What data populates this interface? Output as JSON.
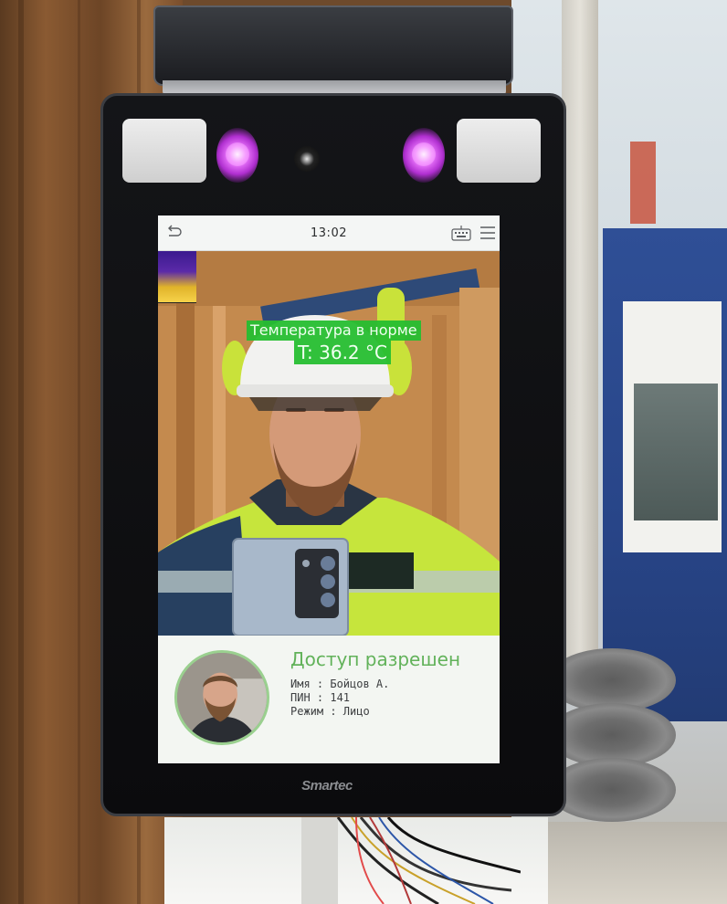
{
  "device": {
    "brand": "Smartec"
  },
  "status_bar": {
    "time": "13:02",
    "back_icon": "back-arrow-icon",
    "keyboard_icon": "keyboard-icon",
    "menu_icon": "hamburger-menu-icon"
  },
  "camera_feed": {
    "temperature_status": "Температура в норме",
    "temperature_value": "T: 36.2 °C",
    "status_color": "#26be30"
  },
  "access_panel": {
    "title": "Доступ разрешен",
    "name_line": "Имя : Бойцов  А.",
    "pin_line": "ПИН : 141",
    "mode_line": "Режим : Лицо",
    "title_color": "#62b25a"
  }
}
